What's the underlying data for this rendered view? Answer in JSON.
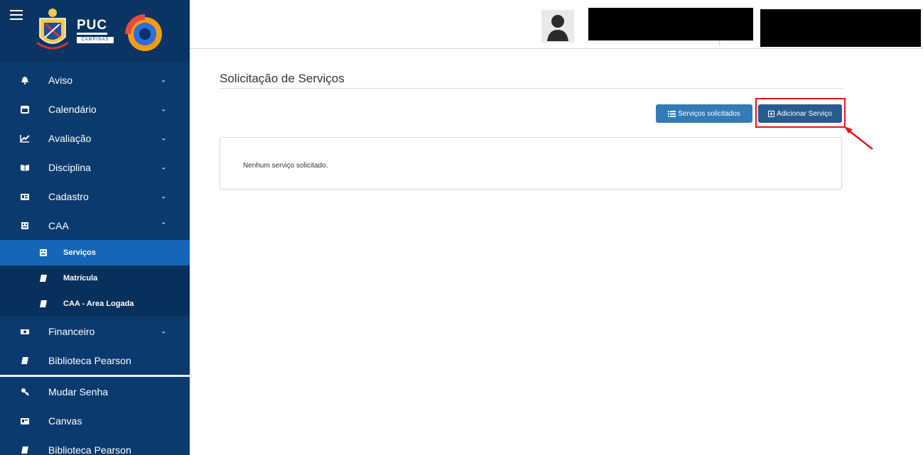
{
  "brand": {
    "name": "PUC",
    "subtitle": "CAMPINAS"
  },
  "sidebar": {
    "items": [
      {
        "label": "Aviso",
        "icon": "bell-icon",
        "chevron": "⌄"
      },
      {
        "label": "Calendário",
        "icon": "calendar-icon",
        "chevron": "⌄"
      },
      {
        "label": "Avaliação",
        "icon": "chart-line-icon",
        "chevron": "⌄"
      },
      {
        "label": "Disciplina",
        "icon": "book-open-icon",
        "chevron": "⌄"
      },
      {
        "label": "Cadastro",
        "icon": "id-card-icon",
        "chevron": "⌄"
      },
      {
        "label": "CAA",
        "icon": "building-icon",
        "chevron": "⌃"
      }
    ],
    "sub_items": [
      {
        "label": "Serviços",
        "icon": "building-icon",
        "active": true
      },
      {
        "label": "Matrícula",
        "icon": "book-icon"
      },
      {
        "label": "CAA - Area Logada",
        "icon": "book-icon"
      }
    ],
    "items_after": [
      {
        "label": "Financeiro",
        "icon": "money-icon",
        "chevron": "⌄"
      },
      {
        "label": "Biblioteca Pearson",
        "icon": "book-icon"
      }
    ],
    "bottom_items": [
      {
        "label": "Mudar Senha",
        "icon": "key-icon"
      },
      {
        "label": "Canvas",
        "icon": "card-icon"
      },
      {
        "label": "Biblioteca Pearson",
        "icon": "book-icon"
      }
    ]
  },
  "main": {
    "title": "Solicitação de Serviços",
    "buttons": {
      "solicitados": "Serviços solicitados",
      "adicionar": "Adicionar Serviço"
    },
    "empty_message": "Nenhum serviço solicitado."
  },
  "colors": {
    "sidebar": "#0b3a6e",
    "active": "#1565b8",
    "primary_button": "#337ab7",
    "highlight": "#e8121c"
  }
}
